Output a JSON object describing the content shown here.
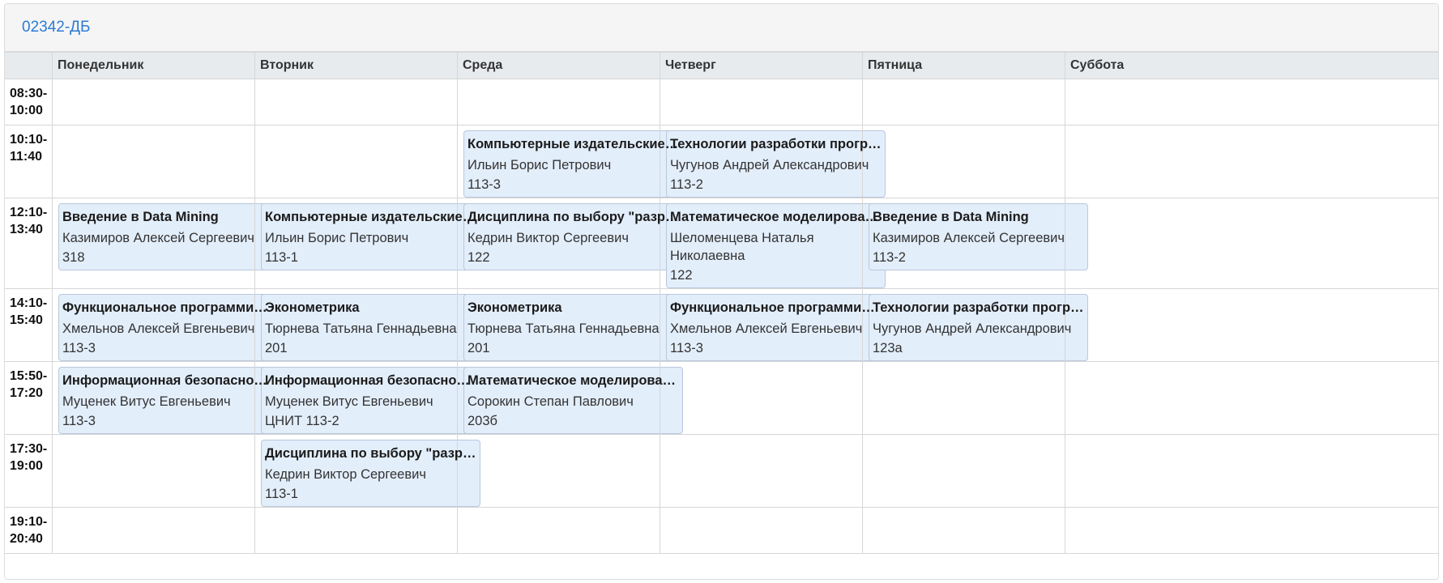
{
  "group": "02342-ДБ",
  "days": [
    "Понедельник",
    "Вторник",
    "Среда",
    "Четверг",
    "Пятница",
    "Суббота"
  ],
  "rows": [
    {
      "time_start": "08:30-",
      "time_end": "10:00",
      "cells": [
        null,
        null,
        null,
        null,
        null,
        null
      ]
    },
    {
      "time_start": "10:10-",
      "time_end": "11:40",
      "cells": [
        null,
        null,
        {
          "subject": "Компьютерные издательские системы",
          "teacher": "Ильин Борис Петрович",
          "room": "113-3"
        },
        {
          "subject": "Технологии разработки программного обеспечения",
          "teacher": "Чугунов Андрей Александрович",
          "room": "113-2"
        },
        null,
        null
      ]
    },
    {
      "time_start": "12:10-",
      "time_end": "13:40",
      "cells": [
        {
          "subject": "Введение в Data Mining",
          "teacher": "Казимиров Алексей Сергеевич",
          "room": "318"
        },
        {
          "subject": "Компьютерные издательские системы",
          "teacher": "Ильин Борис Петрович",
          "room": "113-1"
        },
        {
          "subject": "Дисциплина по выбору \"разработка\"",
          "teacher": "Кедрин Виктор Сергеевич",
          "room": "122"
        },
        {
          "subject": "Математическое моделирование",
          "teacher": "Шеломенцева Наталья Николаевна",
          "room": "122"
        },
        {
          "subject": "Введение в Data Mining",
          "teacher": "Казимиров Алексей Сергеевич",
          "room": "113-2"
        },
        null
      ]
    },
    {
      "time_start": "14:10-",
      "time_end": "15:40",
      "cells": [
        {
          "subject": "Функциональное программирование",
          "teacher": "Хмельнов Алексей Евгеньевич",
          "room": "113-3"
        },
        {
          "subject": "Эконометрика",
          "teacher": "Тюрнева Татьяна Геннадьевна",
          "room": "201"
        },
        {
          "subject": "Эконометрика",
          "teacher": "Тюрнева Татьяна Геннадьевна",
          "room": "201"
        },
        {
          "subject": "Функциональное программирование",
          "teacher": "Хмельнов Алексей Евгеньевич",
          "room": "113-3"
        },
        {
          "subject": "Технологии разработки программного обеспечения",
          "teacher": "Чугунов Андрей Александрович",
          "room": "123а"
        },
        null
      ]
    },
    {
      "time_start": "15:50-",
      "time_end": "17:20",
      "cells": [
        {
          "subject": "Информационная безопасность",
          "teacher": "Муценек Витус Евгеньевич",
          "room": "113-3"
        },
        {
          "subject": "Информационная безопасность",
          "teacher": "Муценек Витус Евгеньевич",
          "room": "ЦНИТ 113-2"
        },
        {
          "subject": "Математическое моделирование",
          "teacher": "Сорокин Степан Павлович",
          "room": "203б"
        },
        null,
        null,
        null
      ]
    },
    {
      "time_start": "17:30-",
      "time_end": "19:00",
      "cells": [
        null,
        {
          "subject": "Дисциплина по выбору \"разработка\"",
          "teacher": "Кедрин Виктор Сергеевич",
          "room": "113-1"
        },
        null,
        null,
        null,
        null
      ]
    },
    {
      "time_start": "19:10-",
      "time_end": "20:40",
      "cells": [
        null,
        null,
        null,
        null,
        null,
        null
      ]
    }
  ]
}
